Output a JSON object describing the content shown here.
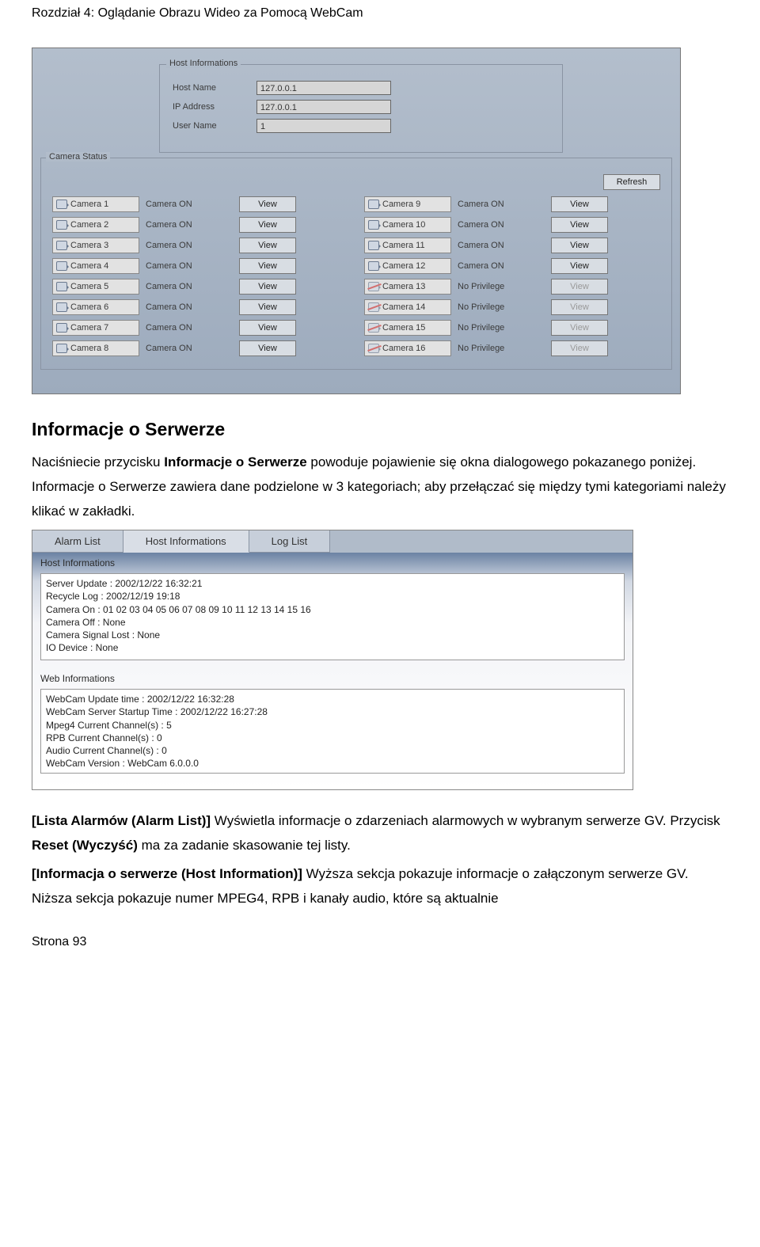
{
  "doc": {
    "header": "Rozdział 4:   Oglądanie Obrazu Wideo za Pomocą WebCam",
    "h2": "Informacje o Serwerze",
    "p1_a": "Naciśniecie przycisku ",
    "p1_b": "Informacje o Serwerze",
    "p1_c": " powoduje pojawienie się okna dialogowego pokazanego poniżej. Informacje o Serwerze zawiera dane podzielone w 3 kategoriach; aby przełączać się między tymi kategoriami należy klikać w zakładki.",
    "p2_a": "[Lista Alarmów (Alarm List)]",
    "p2_b": "   Wyświetla informacje o zdarzeniach alarmowych w wybranym serwerze GV. Przycisk ",
    "p2_c": "Reset (Wyczyść)",
    "p2_d": " ma za zadanie skasowanie tej listy.",
    "p3_a": "[Informacja o serwerze (Host Information)]",
    "p3_b": "   Wyższa sekcja pokazuje informacje o załączonym serwerze GV. Niższa sekcja pokazuje numer MPEG4, RPB i kanały audio, które są aktualnie",
    "footer": "Strona 93"
  },
  "ss1": {
    "host_legend": "Host Informations",
    "cam_legend": "Camera Status",
    "rows": {
      "host_name_lbl": "Host Name",
      "host_name_val": "127.0.0.1",
      "ip_lbl": "IP Address",
      "ip_val": "127.0.0.1",
      "user_lbl": "User Name",
      "user_val": "1"
    },
    "refresh": "Refresh",
    "view": "View",
    "left": [
      {
        "name": "Camera 1",
        "status": "Camera ON",
        "on": true,
        "enabled": true
      },
      {
        "name": "Camera 2",
        "status": "Camera ON",
        "on": true,
        "enabled": true
      },
      {
        "name": "Camera 3",
        "status": "Camera ON",
        "on": true,
        "enabled": true
      },
      {
        "name": "Camera 4",
        "status": "Camera ON",
        "on": true,
        "enabled": true
      },
      {
        "name": "Camera 5",
        "status": "Camera ON",
        "on": true,
        "enabled": true
      },
      {
        "name": "Camera 6",
        "status": "Camera ON",
        "on": true,
        "enabled": true
      },
      {
        "name": "Camera 7",
        "status": "Camera ON",
        "on": true,
        "enabled": true
      },
      {
        "name": "Camera 8",
        "status": "Camera ON",
        "on": true,
        "enabled": true
      }
    ],
    "right": [
      {
        "name": "Camera 9",
        "status": "Camera ON",
        "on": true,
        "enabled": true
      },
      {
        "name": "Camera 10",
        "status": "Camera ON",
        "on": true,
        "enabled": true
      },
      {
        "name": "Camera 11",
        "status": "Camera ON",
        "on": true,
        "enabled": true
      },
      {
        "name": "Camera 12",
        "status": "Camera ON",
        "on": true,
        "enabled": true
      },
      {
        "name": "Camera 13",
        "status": "No Privilege",
        "on": false,
        "enabled": false
      },
      {
        "name": "Camera 14",
        "status": "No Privilege",
        "on": false,
        "enabled": false
      },
      {
        "name": "Camera 15",
        "status": "No Privilege",
        "on": false,
        "enabled": false
      },
      {
        "name": "Camera 16",
        "status": "No Privilege",
        "on": false,
        "enabled": false
      }
    ]
  },
  "ss2": {
    "tabs": {
      "alarm": "Alarm List",
      "host": "Host Informations",
      "log": "Log List"
    },
    "host_title": "Host Informations",
    "host_lines": [
      "Server Update : 2002/12/22 16:32:21",
      "Recycle Log : 2002/12/19 19:18",
      "Camera On : 01 02 03 04 05 06 07 08 09 10 11 12 13 14 15 16",
      "Camera Off : None",
      "Camera Signal Lost : None",
      "IO Device : None"
    ],
    "web_title": "Web Informations",
    "web_lines": [
      "WebCam Update time : 2002/12/22 16:32:28",
      "WebCam Server Startup Time : 2002/12/22 16:27:28",
      "Mpeg4 Current Channel(s) : 5",
      "RPB Current Channel(s) : 0",
      "Audio Current Channel(s) : 0",
      "WebCam Version : WebCam 6.0.0.0"
    ]
  }
}
